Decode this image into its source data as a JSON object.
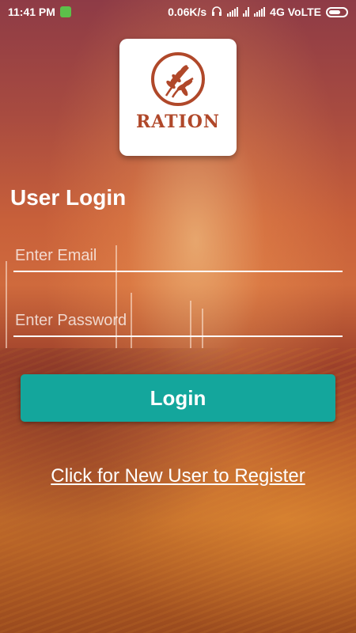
{
  "status_bar": {
    "time": "11:41 PM",
    "speed": "0.06K/s",
    "network": "4G VoLTE",
    "icons": [
      "app-badge-icon",
      "headphones-icon",
      "signal-icon",
      "signal-icon",
      "signal-icon",
      "battery-icon"
    ]
  },
  "logo": {
    "text": "RATION",
    "icon": "wheat-icon",
    "color": "#b0482a"
  },
  "page": {
    "title": "User Login"
  },
  "form": {
    "email_placeholder": "Enter Email",
    "password_placeholder": "Enter Password",
    "login_label": "Login",
    "register_link": "Click for New User to Register"
  },
  "colors": {
    "accent": "#14a69c",
    "text": "#ffffff"
  }
}
